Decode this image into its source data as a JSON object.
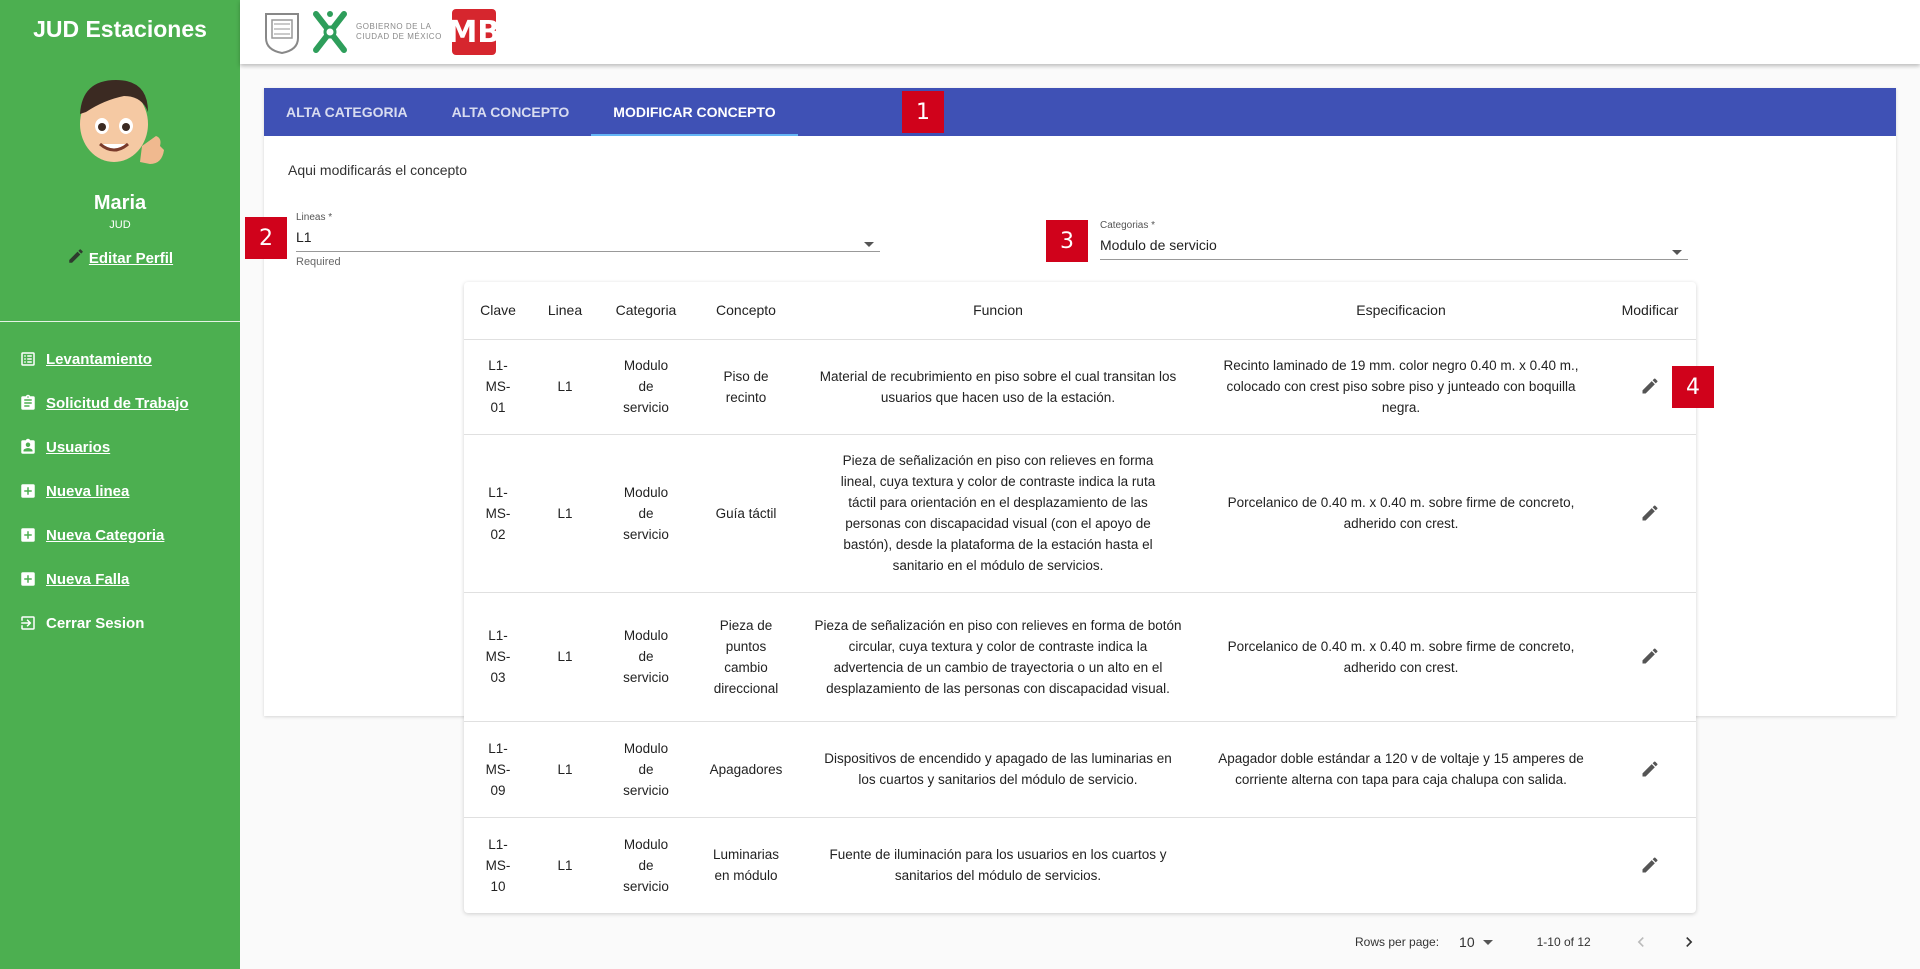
{
  "sidebar": {
    "app_title": "JUD Estaciones",
    "user_name": "Maria",
    "user_role": "JUD",
    "edit_profile": "Editar Perfil",
    "items": [
      {
        "label": "Levantamiento",
        "icon": "list-icon"
      },
      {
        "label": "Solicitud de Trabajo",
        "icon": "clipboard-icon"
      },
      {
        "label": "Usuarios",
        "icon": "user-badge-icon"
      },
      {
        "label": "Nueva linea",
        "icon": "plus-box-icon"
      },
      {
        "label": "Nueva Categoria",
        "icon": "plus-box-icon"
      },
      {
        "label": "Nueva Falla",
        "icon": "plus-box-icon"
      },
      {
        "label": "Cerrar Sesion",
        "icon": "exit-icon"
      }
    ]
  },
  "header": {
    "logo_text_line1": "GOBIERNO DE LA",
    "logo_text_line2": "CIUDAD DE MÉXICO",
    "mb_logo": "MB"
  },
  "tabs": [
    {
      "label": "ALTA CATEGORIA"
    },
    {
      "label": "ALTA CONCEPTO"
    },
    {
      "label": "MODIFICAR CONCEPTO",
      "active": true
    }
  ],
  "intro": "Aqui modificarás el concepto",
  "lineas": {
    "label": "Lineas *",
    "value": "L1",
    "helper": "Required"
  },
  "categorias": {
    "label": "Categorias *",
    "value": "Modulo de servicio"
  },
  "badges": [
    "1",
    "2",
    "3",
    "4"
  ],
  "table": {
    "headers": [
      "Clave",
      "Linea",
      "Categoria",
      "Concepto",
      "Funcion",
      "Especificacion",
      "Modificar"
    ],
    "rows": [
      {
        "clave": "L1-MS-01",
        "linea": "L1",
        "categoria": "Modulo de servicio",
        "concepto": "Piso de recinto",
        "funcion": "Material de recubrimiento en piso sobre el cual transitan los usuarios que hacen uso de la estación.",
        "especificacion": "Recinto laminado de 19 mm. color negro 0.40 m. x 0.40 m., colocado con crest piso sobre piso y junteado con boquilla negra."
      },
      {
        "clave": "L1-MS-02",
        "linea": "L1",
        "categoria": "Modulo de servicio",
        "concepto": "Guía táctil",
        "funcion": "Pieza de señalización en piso con relieves en forma lineal, cuya textura y color de contraste indica la ruta táctil para orientación en el desplazamiento de las personas con discapacidad visual (con el apoyo de bastón), desde la plataforma de la estación hasta el sanitario en el módulo de servicios.",
        "especificacion": "Porcelanico de 0.40 m. x 0.40 m. sobre firme de concreto, adherido con crest."
      },
      {
        "clave": "L1-MS-03",
        "linea": "L1",
        "categoria": "Modulo de servicio",
        "concepto": "Pieza de puntos cambio direccional",
        "funcion": "Pieza de señalización en piso con relieves en forma de botón circular, cuya textura y color de contraste indica la advertencia de un cambio de trayectoria o un alto en el desplazamiento de las personas con discapacidad visual.",
        "especificacion": "Porcelanico de 0.40 m. x 0.40 m. sobre firme de concreto, adherido con crest."
      },
      {
        "clave": "L1-MS-09",
        "linea": "L1",
        "categoria": "Modulo de servicio",
        "concepto": "Apagadores",
        "funcion": "Dispositivos de encendido y apagado de las luminarias en los cuartos y sanitarios del módulo de servicio.",
        "especificacion": "Apagador doble estándar a 120 v de voltaje y 15 amperes de corriente alterna con tapa para caja chalupa con salida."
      },
      {
        "clave": "L1-MS-10",
        "linea": "L1",
        "categoria": "Modulo de servicio",
        "concepto": "Luminarias en módulo",
        "funcion": "Fuente de iluminación para los usuarios en los cuartos y sanitarios del módulo de servicios.",
        "especificacion": ""
      }
    ]
  },
  "pagination": {
    "rows_label": "Rows per page:",
    "rows_value": "10",
    "range": "1-10 of 12"
  },
  "colors": {
    "sidebar": "#4caf50",
    "tabs": "#3f51b5",
    "badge": "#d0021b",
    "mb_logo": "#d6262e"
  }
}
